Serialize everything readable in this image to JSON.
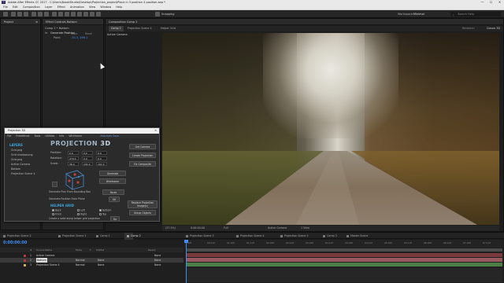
{
  "window": {
    "app_icon_text": "Ae",
    "title": "Adobe After Effects CC 2017 - C:\\Users\\NaokiStudio\\Desktop\\Projection_project\\Place in 3 position 4 position.aep *",
    "controls": [
      "—",
      "☐",
      "✕"
    ]
  },
  "menu": [
    "File",
    "Edit",
    "Composition",
    "Layer",
    "Effect",
    "Animation",
    "View",
    "Window",
    "Help"
  ],
  "toolbar": {
    "snapping": "Snapping",
    "workspace_label": "Workspace:",
    "workspace_value": "Minimal",
    "search_placeholder": "Search Help"
  },
  "project_panel": {
    "title": "Project",
    "menu_icon": "≡"
  },
  "effect_controls": {
    "title": "Effect Controls Bottom",
    "layer_path": "Comp 2 • Bottom",
    "effect_name": "Generate Position",
    "column_store": "Store",
    "column_reset": "Reset",
    "point_label": "Point",
    "point_value": "-34.3, 266.1",
    "fx_badge": "fx"
  },
  "composition_panel": {
    "title": "Composition Comp 2",
    "tabs": [
      "Comp 2",
      "Projection Scene 4",
      "Helper Grid"
    ],
    "renderer_label": "Renderer:",
    "renderer_value": "Classic 3D",
    "active_camera_label": "Active Camera",
    "viewer_bar": {
      "zoom": "(37.5%)",
      "time": "0:00:00:00",
      "resolution": "Full",
      "view": "Active Camera",
      "view_count": "1 View"
    }
  },
  "projection3d": {
    "title": "Projection 3D",
    "close": "✕",
    "menu": [
      "File",
      "Predefined",
      "Tools",
      "Utilities",
      "Info",
      "Wireframe"
    ],
    "docs_link": "Aescripts Docs",
    "layers_heading": "LAYERS",
    "layers": [
      "Grid.png",
      "Grid shadow.png",
      "Grid.png",
      "Active Camera",
      "Bottom",
      "Projection Scene 4"
    ],
    "logo_word": "PROJECTION",
    "logo_num": "3D",
    "position_label": "Position:",
    "rotation_label": "Rotation:",
    "scale_label": "Scale:",
    "position_x": "0.0",
    "position_y": "0.0",
    "position_z": "0.0",
    "rotation_x": "270.0",
    "rotation_y": "0.0",
    "rotation_z": "0.0",
    "scale_x": "36.0",
    "scale_y": "101.0",
    "scale_z": "101.0",
    "btn_get_camera": "Get Camera",
    "btn_create_projection": "Create Projection",
    "btn_fix_composite": "Fix Composite",
    "btn_generate": "Generate",
    "btn_wireframe": "Wireframe",
    "btn_replace": "Replace Projection Image(s)",
    "btn_group": "Group Objects",
    "btn_ok": "OK",
    "btn_go": "Go",
    "faces_label": "Faces",
    "note_bounding": "Generate Plan From Bounding Box",
    "note_position": "Generate Position From Plane",
    "helper_heading": "HELPER GRID",
    "helper_back": "Back",
    "helper_left": "Left",
    "helper_bottom": "Bottom",
    "helper_front": "Front",
    "helper_right": "Right",
    "helper_top": "Top",
    "helper_note": "Create a solid along helper grid projection"
  },
  "timeline_tabs": [
    "Projection Scene 2",
    "Projection Scene 1",
    "Comp 1",
    "Comp 2",
    "Projection Scene 3",
    "Projection Scene 4",
    "Projection Scene 5",
    "Comp 3",
    "Master Scene"
  ],
  "timeline": {
    "current_time": "0:00:00:00",
    "columns": [
      "#",
      "Source Name",
      "Mode",
      "T",
      "TrkMat",
      "Parent"
    ],
    "rows": [
      {
        "num": "1",
        "name": "Active Camera",
        "mode": "",
        "trkmat": "",
        "parent": "None",
        "color": "#b4373c"
      },
      {
        "num": "2",
        "name": "Bottom",
        "mode": "Normal",
        "trkmat": "None",
        "parent": "None",
        "color": "#b4373c"
      },
      {
        "num": "3",
        "name": "Projection Scene 4",
        "mode": "Normal",
        "trkmat": "None",
        "parent": "None",
        "color": "#c8b454"
      }
    ],
    "ruler": [
      "00f",
      "00:12f",
      "01:00f",
      "01:12f",
      "02:00f",
      "02:12f",
      "03:00f",
      "03:12f",
      "04:00f",
      "04:12f",
      "05:00f",
      "05:12f",
      "06:00f",
      "06:12f",
      "07:00f",
      "07:12f"
    ]
  },
  "colors": {
    "accent_blue": "#3d8df5",
    "p3d_heading": "#3ea7e0",
    "bar_green": "#4b7f45",
    "bar_red": "#7a3a3c",
    "bar_pink": "#9a5a60"
  }
}
